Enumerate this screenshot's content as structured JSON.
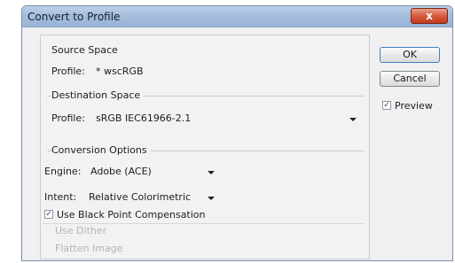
{
  "window": {
    "title": "Convert to Profile",
    "close_glyph": "x"
  },
  "source_space": {
    "title": "Source Space",
    "profile_label": "Profile:",
    "profile_value": "* wscRGB"
  },
  "destination_space": {
    "title": "Destination Space",
    "profile_label": "Profile:",
    "profile_value": "sRGB IEC61966-2.1"
  },
  "conversion_options": {
    "title": "Conversion Options",
    "engine_label": "Engine:",
    "engine_value": "Adobe (ACE)",
    "intent_label": "Intent:",
    "intent_value": "Relative Colorimetric",
    "bpc_label": "Use Black Point Compensation",
    "bpc_checked": true,
    "dither_label": "Use Dither",
    "flatten_label": "Flatten Image"
  },
  "buttons": {
    "ok": "OK",
    "cancel": "Cancel"
  },
  "preview": {
    "label": "Preview",
    "checked": true
  },
  "check_glyph": "✓",
  "colors": {
    "titlebar": "#a6bddc",
    "close_button": "#d55b3f",
    "disabled_text": "#b4b4b4"
  }
}
